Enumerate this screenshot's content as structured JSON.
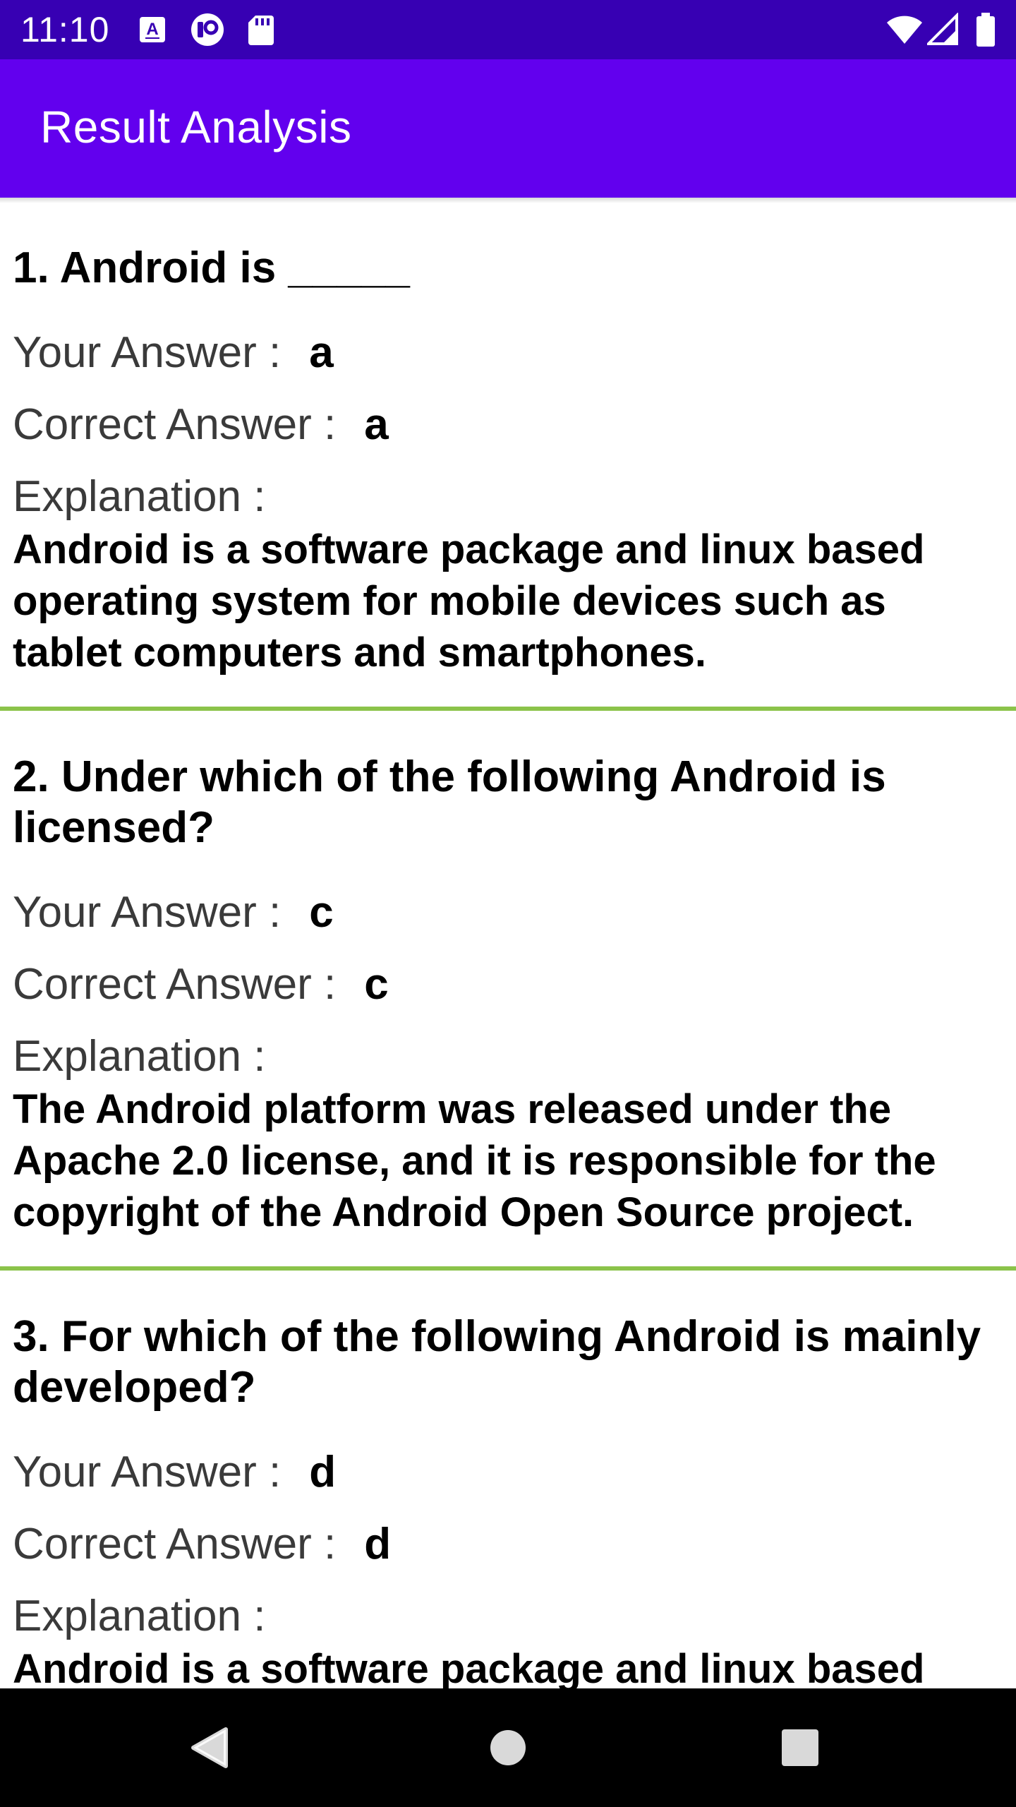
{
  "status_bar": {
    "time": "11:10",
    "icons": [
      "accessibility-icon",
      "vpn-icon",
      "sd-card-icon",
      "wifi-icon",
      "signal-icon",
      "battery-icon"
    ]
  },
  "app_bar": {
    "title": "Result Analysis"
  },
  "questions": [
    {
      "title": "1. Android is _____",
      "your_label": "Your Answer :",
      "your_value": "a",
      "correct_label": "Correct Answer :",
      "correct_value": "a",
      "explanation_label": "Explanation :",
      "explanation": "Android is a software package and linux based operating system for mobile devices such as tablet computers and smartphones."
    },
    {
      "title": "2. Under which of the following Android is licensed?",
      "your_label": "Your Answer :",
      "your_value": "c",
      "correct_label": "Correct Answer :",
      "correct_value": "c",
      "explanation_label": "Explanation :",
      "explanation": "The Android platform was released under the Apache 2.0 license, and it is responsible for the copyright of the Android Open Source project."
    },
    {
      "title": "3. For which of the following Android is mainly developed?",
      "your_label": "Your Answer :",
      "your_value": "d",
      "correct_label": "Correct Answer :",
      "correct_value": "d",
      "explanation_label": "Explanation :",
      "explanation": "Android is a software package and linux based operating system for mobile devices such as tablet computers and smartphones."
    }
  ],
  "colors": {
    "status_bar": "#3700b3",
    "app_bar": "#6200ee",
    "divider": "#8bc34a",
    "nav_bar": "#000000"
  },
  "nav_bar": {
    "icons": [
      "back-icon",
      "home-icon",
      "recents-icon"
    ]
  }
}
